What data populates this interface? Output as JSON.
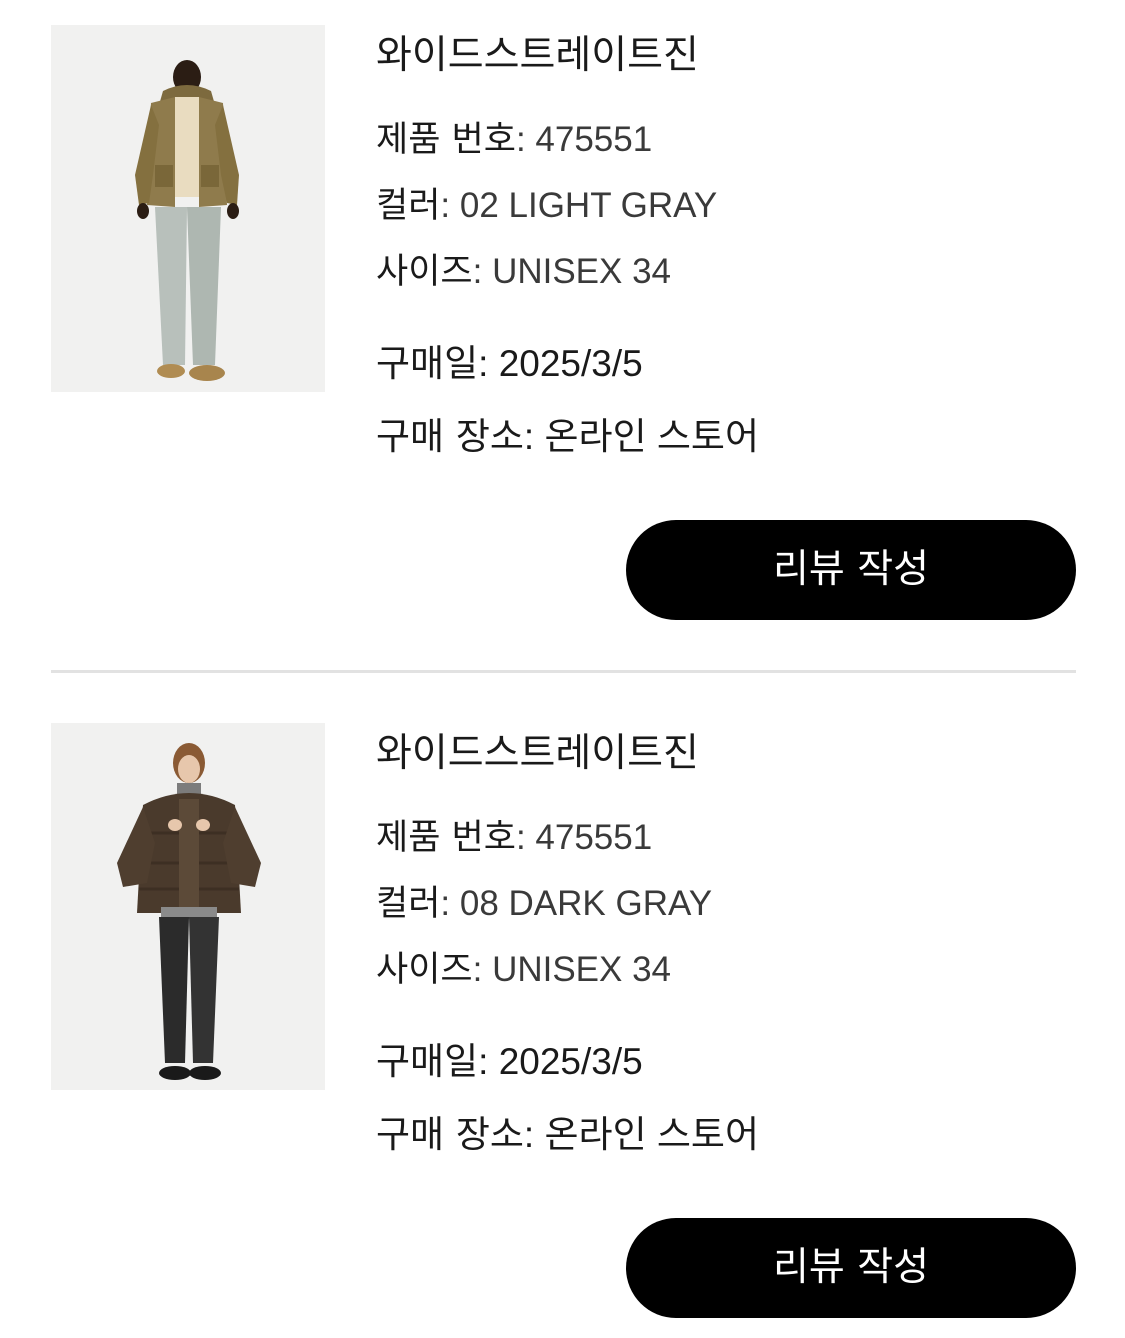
{
  "orders": [
    {
      "product_name": "와이드스트레이트진",
      "product_number_label": "제품 번호",
      "product_number": "475551",
      "color_label": "컬러",
      "color": "02 LIGHT GRAY",
      "size_label": "사이즈",
      "size": "UNISEX 34",
      "purchase_date_label": "구매일",
      "purchase_date": "2025/3/5",
      "purchase_place_label": "구매 장소",
      "purchase_place": "온라인 스토어",
      "review_button_label": "리뷰 작성",
      "thumbnail": {
        "icon": "product-photo-olive-jacket-light-jeans",
        "jacket_color": "#8f7b4c",
        "pants_color": "#b8c0bb"
      }
    },
    {
      "product_name": "와이드스트레이트진",
      "product_number_label": "제품 번호",
      "product_number": "475551",
      "color_label": "컬러",
      "color": "08 DARK GRAY",
      "size_label": "사이즈",
      "size": "UNISEX 34",
      "purchase_date_label": "구매일",
      "purchase_date": "2025/3/5",
      "purchase_place_label": "구매 장소",
      "purchase_place": "온라인 스토어",
      "review_button_label": "리뷰 작성",
      "thumbnail": {
        "icon": "product-photo-brown-puffer-dark-jeans",
        "jacket_color": "#4a3a2c",
        "pants_color": "#2b2b2b"
      }
    }
  ],
  "colors": {
    "button_bg": "#000000",
    "button_text": "#ffffff",
    "divider": "#e2e2e2",
    "thumb_bg": "#f1f1f0"
  }
}
